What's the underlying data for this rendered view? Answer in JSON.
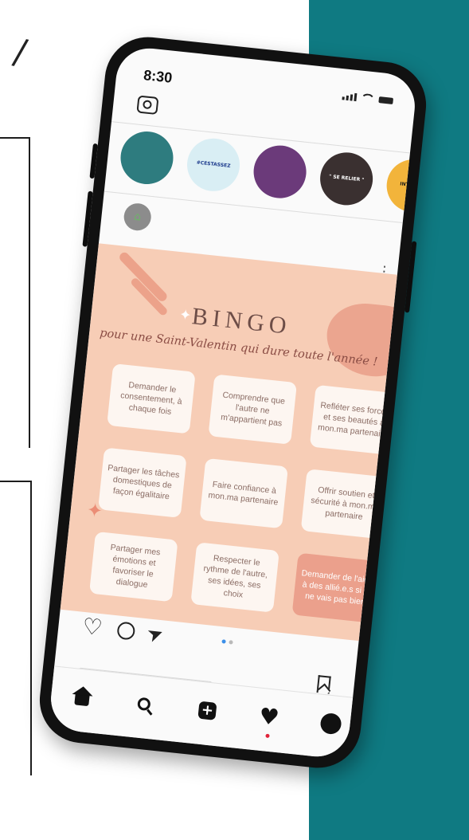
{
  "background": {
    "doodle": "/",
    "panel_color": "#0f7a82"
  },
  "status_bar": {
    "time": "8:30"
  },
  "header": {
    "camera_icon": "camera-icon"
  },
  "stories": [
    {
      "name": "story-1",
      "color": "#2e7c7f",
      "text": ""
    },
    {
      "name": "story-2",
      "color": "#d9eef4",
      "text": "#CESTASSEZ"
    },
    {
      "name": "story-3",
      "color": "#6b3a7a",
      "text": ""
    },
    {
      "name": "story-4",
      "color": "#3a3030",
      "text": "\" SE RELIER \""
    },
    {
      "name": "story-5",
      "color": "#f2b43b",
      "text": "INTERSEC"
    }
  ],
  "post": {
    "title": "BINGO",
    "subtitle": "pour une Saint-Valentin qui dure toute l'année !",
    "cells": [
      "Demander le consentement, à chaque fois",
      "Comprendre que l'autre ne m'appartient pas",
      "Refléter ses forces et ses beautés à mon.ma partenaire",
      "Partager les tâches domestiques de façon égalitaire",
      "Faire confiance à mon.ma partenaire",
      "Offrir soutien et sécurité à mon.ma partenaire",
      "Partager mes émotions et favoriser le dialogue",
      "Respecter le rythme de l'autre, ses idées, ses choix",
      "Demander de l'aide à des allié.e.s si je ne vais pas bien"
    ],
    "background_color": "#f7cdb6",
    "highlight_color": "#eba08c"
  },
  "carousel": {
    "total": 2,
    "active": 1
  },
  "tabbar": {
    "home": "home-icon",
    "search": "search-icon",
    "add": "+",
    "activity": "heart-icon",
    "profile": "profile-icon"
  }
}
